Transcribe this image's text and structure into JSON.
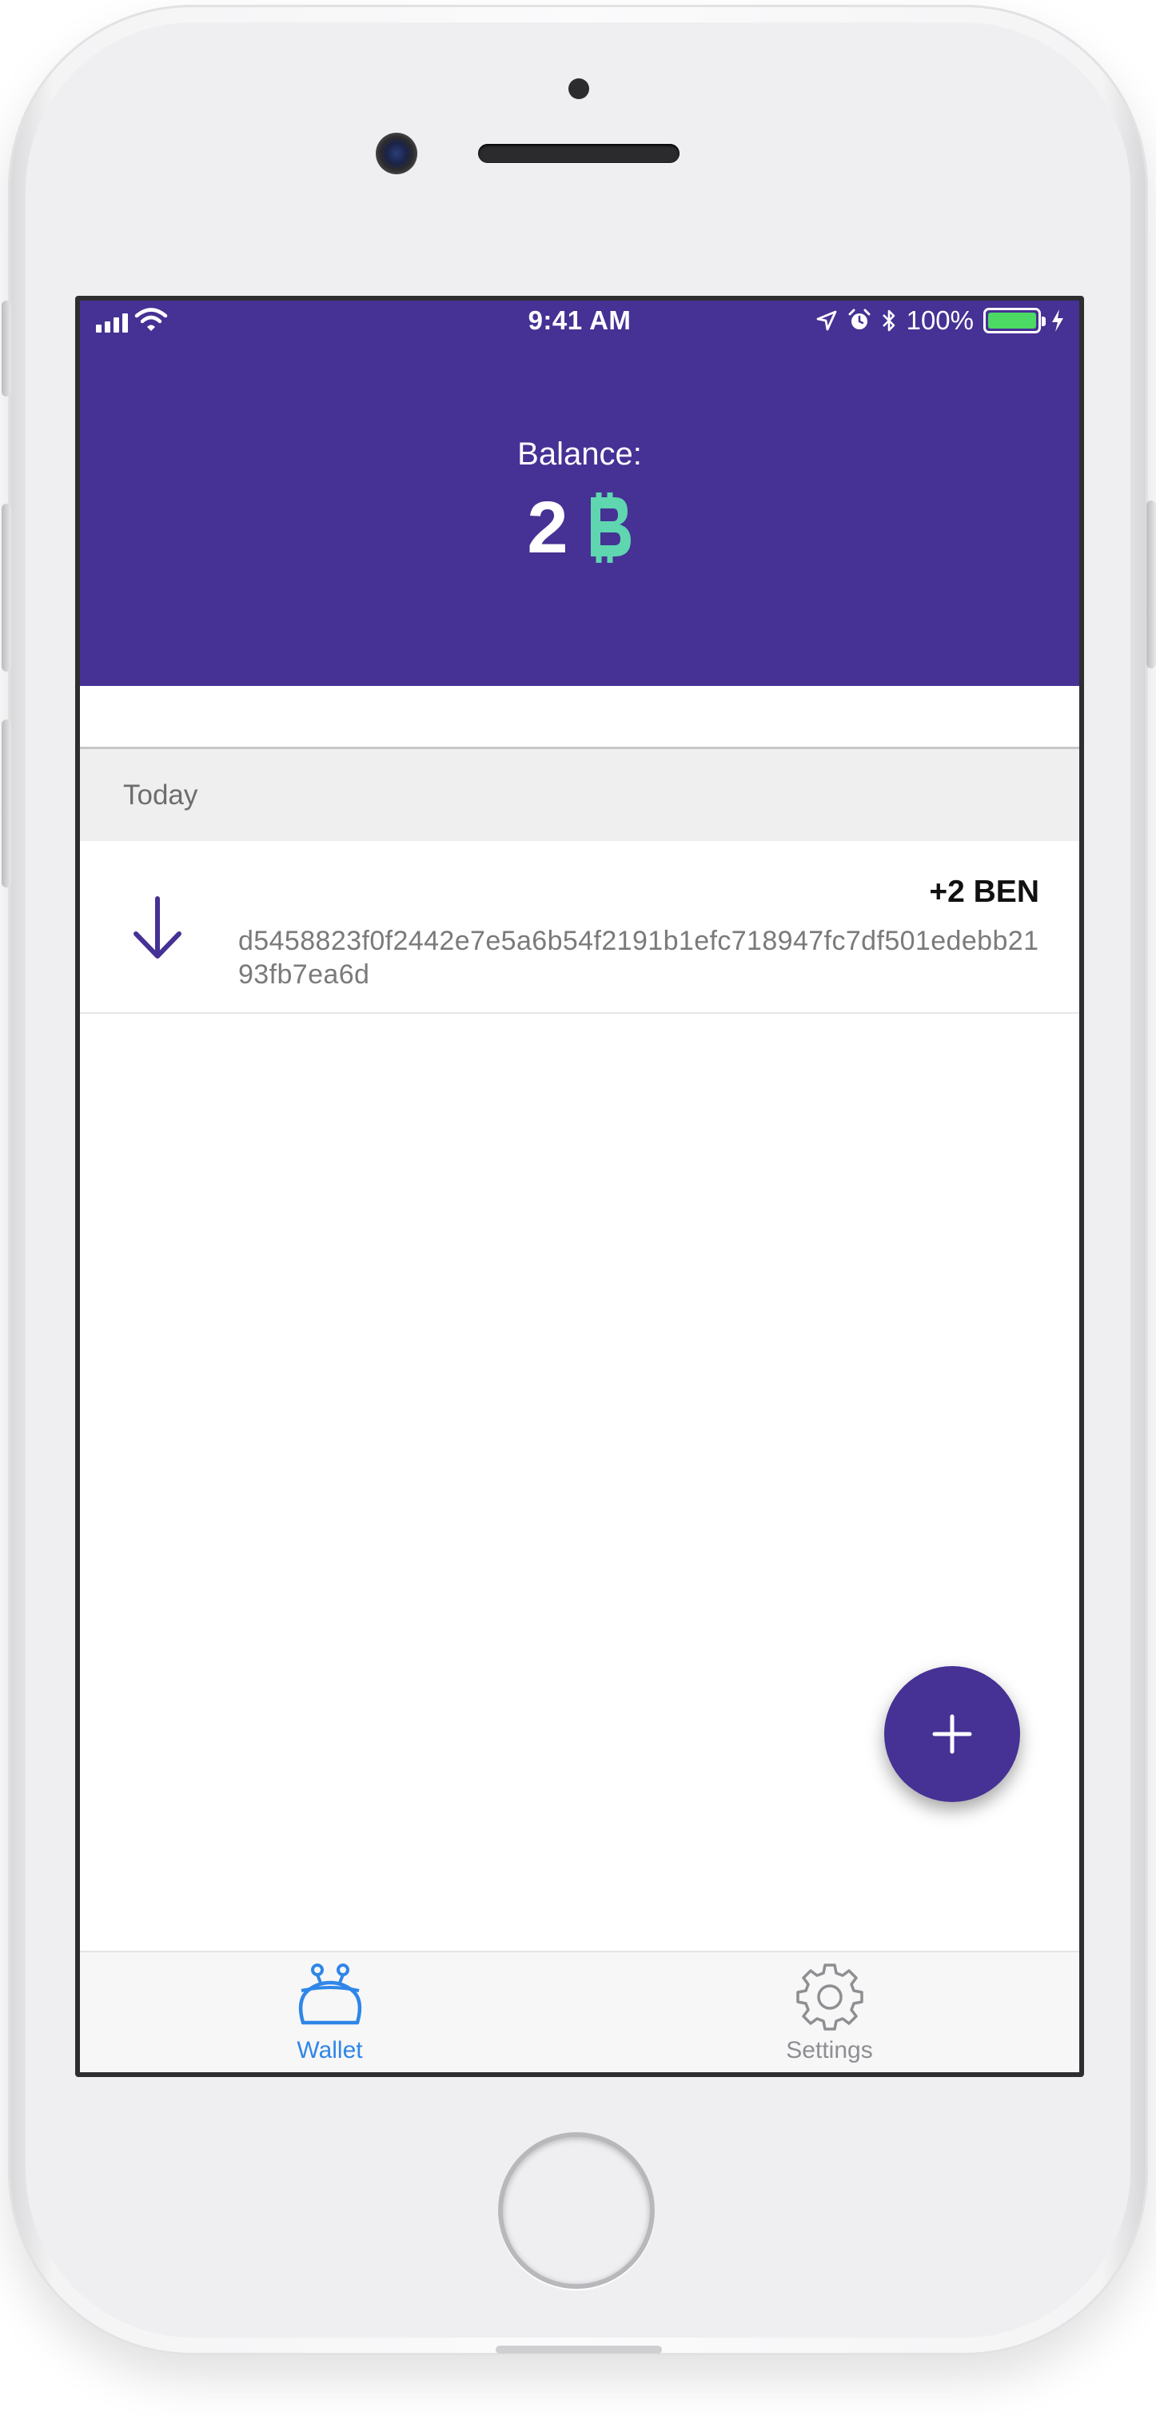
{
  "status_bar": {
    "time": "9:41 AM",
    "battery_percent": "100%",
    "battery_level": 1.0
  },
  "header": {
    "balance_label": "Balance:",
    "balance_value": "2",
    "currency_icon": "ben-coin-icon",
    "background_color": "#463194",
    "coin_color": "#5fd6b0"
  },
  "transactions": {
    "section_label": "Today",
    "items": [
      {
        "direction_icon": "arrow-down-icon",
        "amount": "+2 BEN",
        "hash": "d5458823f0f2442e7e5a6b54f2191b1efc718947fc7df501edebb2193fb7ea6d"
      }
    ]
  },
  "fab": {
    "icon": "plus-icon",
    "color": "#463194"
  },
  "tab_bar": {
    "tabs": [
      {
        "label": "Wallet",
        "icon": "wallet-icon",
        "active": true,
        "color": "#2f86e8"
      },
      {
        "label": "Settings",
        "icon": "gear-icon",
        "active": false,
        "color": "#8e8e93"
      }
    ]
  }
}
